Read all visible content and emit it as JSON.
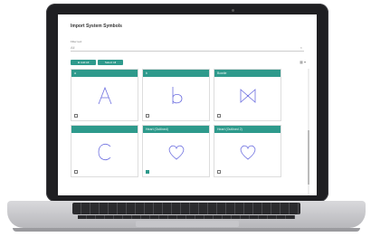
{
  "dialog": {
    "title": "Import System Symbols",
    "filter": {
      "label": "Filter text",
      "value": "All"
    },
    "buttons": {
      "add": "⊕ Add All",
      "select": "Select All"
    },
    "view_toggle_icon": "grid-icon",
    "cards": [
      {
        "label": "a",
        "symbol": "A",
        "checked": false
      },
      {
        "label": "b",
        "symbol": "b",
        "checked": false
      },
      {
        "label": "Bowtie",
        "symbol": "bowtie",
        "checked": false
      },
      {
        "label": "",
        "symbol": "C",
        "checked": false
      },
      {
        "label": "Heart (Outlined)",
        "symbol": "heart",
        "checked": true
      },
      {
        "label": "Heart (Outlined 2)",
        "symbol": "heart",
        "checked": false
      }
    ]
  },
  "colors": {
    "accent": "#2e9a8c",
    "symbol": "#6d6fe0"
  }
}
